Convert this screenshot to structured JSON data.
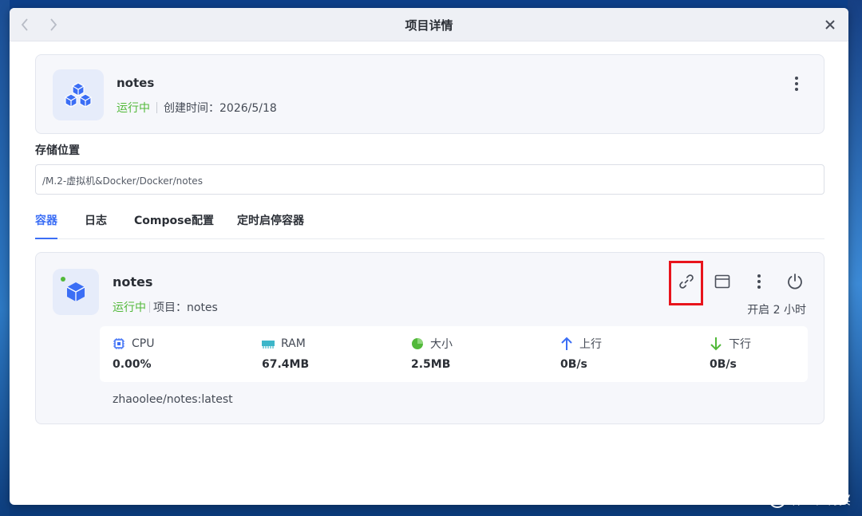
{
  "window": {
    "title": "项目详情"
  },
  "project": {
    "name": "notes",
    "status": "运行中",
    "created": "创建时间：2026/5/18"
  },
  "storage": {
    "label": "存储位置",
    "path": "/M.2-虚拟机&Docker/Docker/notes"
  },
  "tabs": [
    {
      "label": "容器",
      "active": true
    },
    {
      "label": "日志",
      "active": false
    },
    {
      "label": "Compose配置",
      "active": false
    },
    {
      "label": "定时启停容器",
      "active": false
    }
  ],
  "container": {
    "name": "notes",
    "status": "运行中",
    "project": "项目：notes",
    "uptime": "开启 2 小时",
    "image": "zhaoolee/notes:latest",
    "stats": [
      {
        "label": "CPU",
        "value": "0.00%",
        "icon": "cpu-icon",
        "color": "#3b6ef5"
      },
      {
        "label": "RAM",
        "value": "67.4MB",
        "icon": "ram-icon",
        "color": "#3cb6c9"
      },
      {
        "label": "大小",
        "value": "2.5MB",
        "icon": "pie-icon",
        "color": "#52b93a"
      },
      {
        "label": "上行",
        "value": "0B/s",
        "icon": "arrow-up-icon",
        "color": "#3b6ef5"
      },
      {
        "label": "下行",
        "value": "0B/s",
        "icon": "arrow-down-icon",
        "color": "#52b93a"
      }
    ]
  },
  "watermark": {
    "logo": "值",
    "text": "什么值得买"
  },
  "colors": {
    "accent": "#3b6ef5",
    "running": "#52b93a",
    "highlight": "#e8141c"
  }
}
